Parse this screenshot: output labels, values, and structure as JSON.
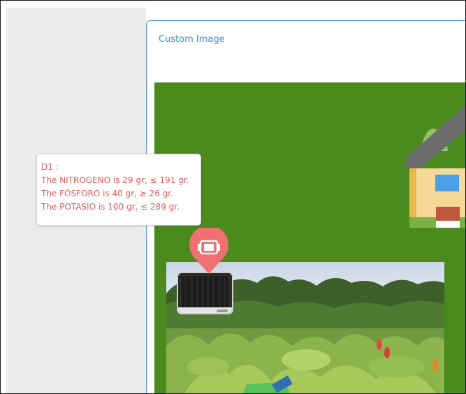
{
  "card": {
    "title": "Custom Image"
  },
  "tooltip": {
    "header": "D1 :",
    "lines": [
      "The NITROGENO is 29 gr, ≤ 191 gr.",
      "The FÓSFORO is 40 gr, ≥ 26 gr.",
      "The POTASIO is 100 gr, ≤ 289 gr."
    ]
  },
  "colors": {
    "field_green": "#4b8a1c",
    "marker_red": "#f07072",
    "tooltip_text": "#e25b5b",
    "title_blue": "#3b8fd0",
    "card_border": "#4a8fc4"
  },
  "icons": {
    "marker": "map-pin-icon",
    "marker_glyph": "sensor-device-icon"
  }
}
